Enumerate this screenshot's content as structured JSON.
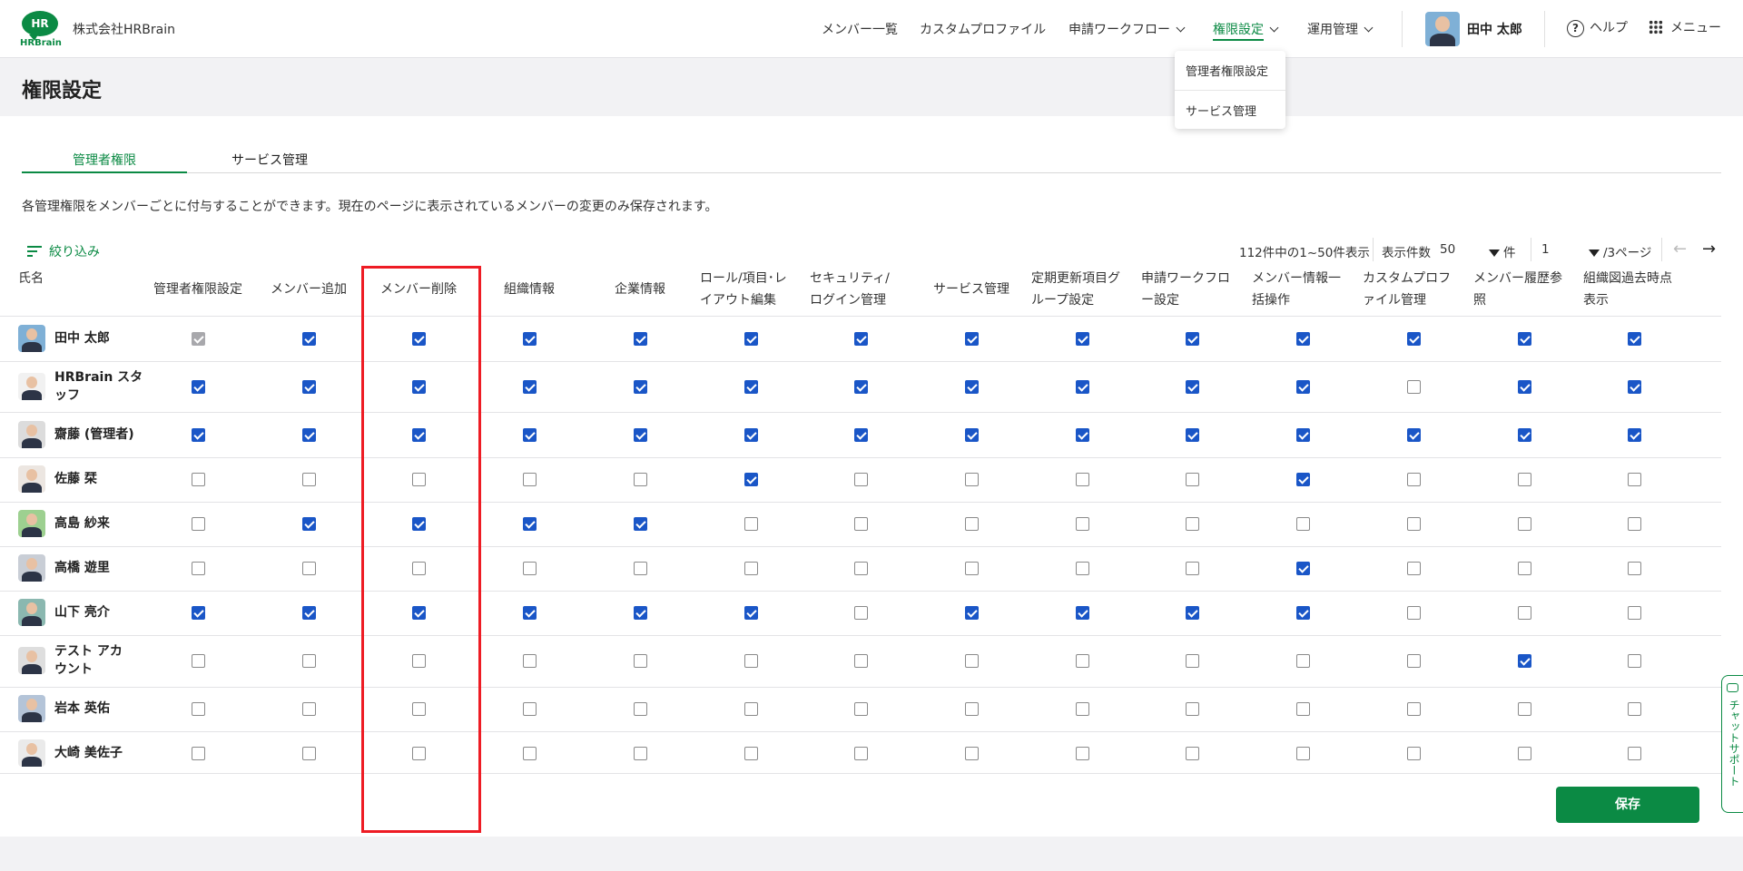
{
  "header": {
    "logo_text": "HR",
    "logo_word": "HRBrain",
    "company": "株式会社HRBrain",
    "nav": [
      "メンバー一覧",
      "カスタムプロファイル",
      "申請ワークフロー",
      "権限設定",
      "運用管理"
    ],
    "user_name": "田中 太郎",
    "help": "ヘルプ",
    "menu": "メニュー"
  },
  "dropdown": {
    "items": [
      "管理者権限設定",
      "サービス管理"
    ]
  },
  "page": {
    "title": "権限設定"
  },
  "tabs": [
    "管理者権限",
    "サービス管理"
  ],
  "description": "各管理権限をメンバーごとに付与することができます。現在のページに表示されているメンバーの変更のみ保存されます。",
  "toolbar": {
    "filter_label": "絞り込み",
    "range_text": "112件中の1~50件表示",
    "per_page_label": "表示件数",
    "per_page_value": "50",
    "per_page_unit": "件",
    "page_value": "1",
    "page_total": "/3ページ",
    "prev_arrow": "←",
    "next_arrow": "→"
  },
  "table": {
    "name_header": "氏名",
    "columns": [
      [
        "管理者権限設定"
      ],
      [
        "メンバー追加"
      ],
      [
        "メンバー削除"
      ],
      [
        "組織情報"
      ],
      [
        "企業情報"
      ],
      [
        "ロール/項目･レ",
        "イアウト編集"
      ],
      [
        "セキュリティ/",
        "ログイン管理"
      ],
      [
        "サービス管理"
      ],
      [
        "定期更新項目グ",
        "ループ設定"
      ],
      [
        "申請ワークフロ",
        "ー設定"
      ],
      [
        "メンバー情報一",
        "括操作"
      ],
      [
        "カスタムプロフ",
        "ァイル管理"
      ],
      [
        "メンバー履歴参",
        "照"
      ],
      [
        "組織図過去時点",
        "表示"
      ]
    ],
    "rows": [
      {
        "name": [
          "田中 太郎"
        ],
        "checks": [
          2,
          1,
          1,
          1,
          1,
          1,
          1,
          1,
          1,
          1,
          1,
          1,
          1,
          1
        ]
      },
      {
        "name": [
          "HRBrain スタ",
          "ッフ"
        ],
        "checks": [
          1,
          1,
          1,
          1,
          1,
          1,
          1,
          1,
          1,
          1,
          1,
          0,
          1,
          1
        ]
      },
      {
        "name": [
          "齋藤 (管理者)"
        ],
        "checks": [
          1,
          1,
          1,
          1,
          1,
          1,
          1,
          1,
          1,
          1,
          1,
          1,
          1,
          1
        ]
      },
      {
        "name": [
          "佐藤 栞"
        ],
        "checks": [
          0,
          0,
          0,
          0,
          0,
          1,
          0,
          0,
          0,
          0,
          1,
          0,
          0,
          0
        ]
      },
      {
        "name": [
          "高島 紗来"
        ],
        "checks": [
          0,
          1,
          1,
          1,
          1,
          0,
          0,
          0,
          0,
          0,
          0,
          0,
          0,
          0
        ]
      },
      {
        "name": [
          "高橋 遊里"
        ],
        "checks": [
          0,
          0,
          0,
          0,
          0,
          0,
          0,
          0,
          0,
          0,
          1,
          0,
          0,
          0
        ]
      },
      {
        "name": [
          "山下 亮介"
        ],
        "checks": [
          1,
          1,
          1,
          1,
          1,
          1,
          0,
          1,
          1,
          1,
          1,
          0,
          0,
          0
        ]
      },
      {
        "name": [
          "テスト アカ",
          "ウント"
        ],
        "checks": [
          0,
          0,
          0,
          0,
          0,
          0,
          0,
          0,
          0,
          0,
          0,
          0,
          1,
          0
        ]
      },
      {
        "name": [
          "岩本 英佑"
        ],
        "checks": [
          0,
          0,
          0,
          0,
          0,
          0,
          0,
          0,
          0,
          0,
          0,
          0,
          0,
          0
        ]
      },
      {
        "name": [
          "大崎 美佐子"
        ],
        "checks": [
          0,
          0,
          0,
          0,
          0,
          0,
          0,
          0,
          0,
          0,
          0,
          0,
          0,
          0
        ]
      }
    ]
  },
  "save_label": "保存",
  "chat_label": "チャットサポート",
  "colors": {
    "brand_green": "#0b8a44",
    "checkbox_blue": "#1a56c7",
    "highlight_red": "#ee1c24"
  }
}
